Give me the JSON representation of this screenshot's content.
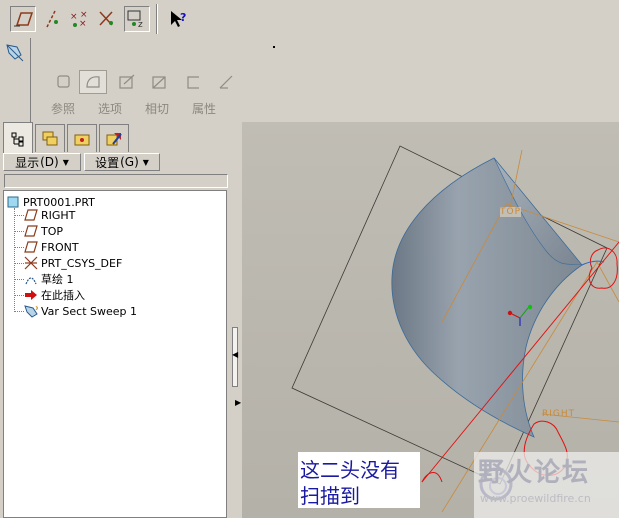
{
  "toolbar": {
    "buttons": [
      {
        "icon": "plane-display-icon",
        "active": true
      },
      {
        "icon": "axis-display-icon",
        "active": false
      },
      {
        "icon": "point-display-icon",
        "active": false
      },
      {
        "icon": "csys-display-icon",
        "active": false
      },
      {
        "icon": "spin-center-icon",
        "active": false
      },
      {
        "icon": "context-help-icon",
        "active": false
      }
    ]
  },
  "dashboard": {
    "tabs": [
      {
        "label": "参照",
        "icon": "references-icon"
      },
      {
        "label": "选项",
        "icon": "options-icon"
      },
      {
        "label": "相切",
        "icon": "tangency-icon"
      },
      {
        "label": "属性",
        "icon": "properties-icon"
      }
    ]
  },
  "model_tree": {
    "tabs": [
      "model-tree-tab",
      "layer-tree-tab",
      "folder-browser-tab",
      "favorites-tab"
    ],
    "show_menu": "显示",
    "show_shortcut": "(D)",
    "settings_menu": "设置",
    "settings_shortcut": "(G)",
    "items": [
      {
        "label": "PRT0001.PRT",
        "icon": "part-icon"
      },
      {
        "label": "RIGHT",
        "icon": "datum-plane-icon"
      },
      {
        "label": "TOP",
        "icon": "datum-plane-icon"
      },
      {
        "label": "FRONT",
        "icon": "datum-plane-icon"
      },
      {
        "label": "PRT_CSYS_DEF",
        "icon": "csys-icon"
      },
      {
        "label": "草绘 1",
        "icon": "sketch-icon"
      },
      {
        "label": "在此插入",
        "icon": "insert-here-icon"
      },
      {
        "label": "Var Sect Sweep 1",
        "icon": "var-sect-sweep-icon"
      }
    ]
  },
  "viewport": {
    "plane_labels": {
      "top": "TOP",
      "right": "RIGHT"
    },
    "annotation": {
      "line1": "这二头没有",
      "line2": "扫描到"
    },
    "watermark": {
      "title": "野火论坛",
      "url": "www.proewildfire.cn"
    }
  },
  "colors": {
    "accent_red": "#e01010",
    "datum_orange": "#c88a3c",
    "annot_text": "#1a1aa0"
  }
}
